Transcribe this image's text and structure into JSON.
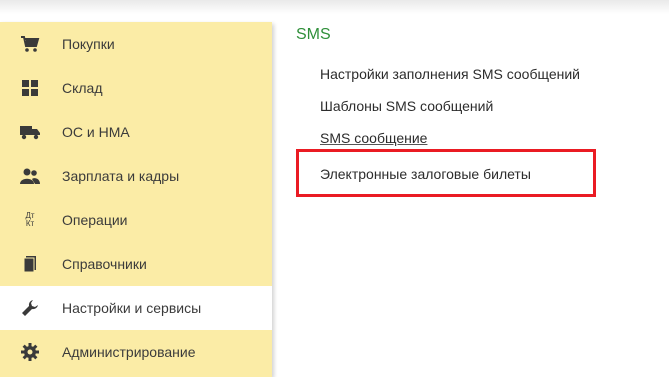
{
  "sidebar": {
    "items": [
      {
        "label": "Покупки",
        "icon": "cart-icon"
      },
      {
        "label": "Склад",
        "icon": "warehouse-grid-icon"
      },
      {
        "label": "ОС и НМА",
        "icon": "truck-icon"
      },
      {
        "label": "Зарплата и кадры",
        "icon": "people-icon"
      },
      {
        "label": "Операции",
        "icon": "debit-credit-icon",
        "icon_text": "Дт Кт"
      },
      {
        "label": "Справочники",
        "icon": "book-icon"
      },
      {
        "label": "Настройки и сервисы",
        "icon": "wrench-icon",
        "active": true
      },
      {
        "label": "Администрирование",
        "icon": "gear-icon"
      }
    ]
  },
  "main": {
    "section_title": "SMS",
    "links": [
      {
        "label": "Настройки заполнения SMS сообщений"
      },
      {
        "label": "Шаблоны SMS сообщений"
      },
      {
        "label": "SMS сообщение"
      },
      {
        "label": "Электронные залоговые билеты"
      }
    ]
  },
  "colors": {
    "sidebar_bg": "#fbeca6",
    "section_title": "#2f8f3a",
    "highlight": "#ea1b23"
  }
}
